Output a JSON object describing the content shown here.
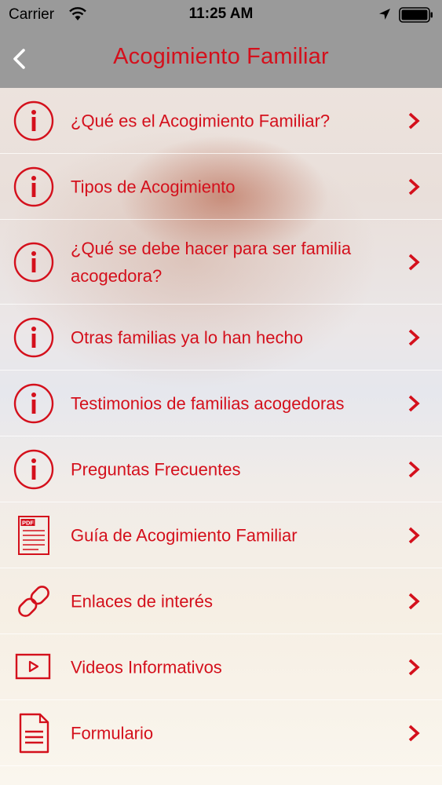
{
  "status_bar": {
    "carrier": "Carrier",
    "time": "11:25 AM",
    "icons": [
      "wifi-icon",
      "location-arrow-icon",
      "battery-icon"
    ]
  },
  "nav": {
    "title": "Acogimiento Familiar",
    "back_icon": "chevron-left-icon"
  },
  "colors": {
    "accent": "#d4101c",
    "nav_background": "#9a9a9a"
  },
  "menu": [
    {
      "label": "¿Qué es el Acogimiento Familiar?",
      "icon": "info-circle-icon"
    },
    {
      "label": "Tipos de Acogimiento",
      "icon": "info-circle-icon"
    },
    {
      "label": "¿Qué se debe hacer para ser familia acogedora?",
      "icon": "info-circle-icon"
    },
    {
      "label": "Otras familias ya lo han hecho",
      "icon": "info-circle-icon"
    },
    {
      "label": "Testimonios de familias acogedoras",
      "icon": "info-circle-icon"
    },
    {
      "label": "Preguntas Frecuentes",
      "icon": "info-circle-icon"
    },
    {
      "label": "Guía de Acogimiento Familiar",
      "icon": "pdf-document-icon",
      "icon_text": "PDF"
    },
    {
      "label": "Enlaces de interés",
      "icon": "link-icon"
    },
    {
      "label": "Videos Informativos",
      "icon": "video-play-icon"
    },
    {
      "label": "Formulario",
      "icon": "form-document-icon"
    }
  ]
}
